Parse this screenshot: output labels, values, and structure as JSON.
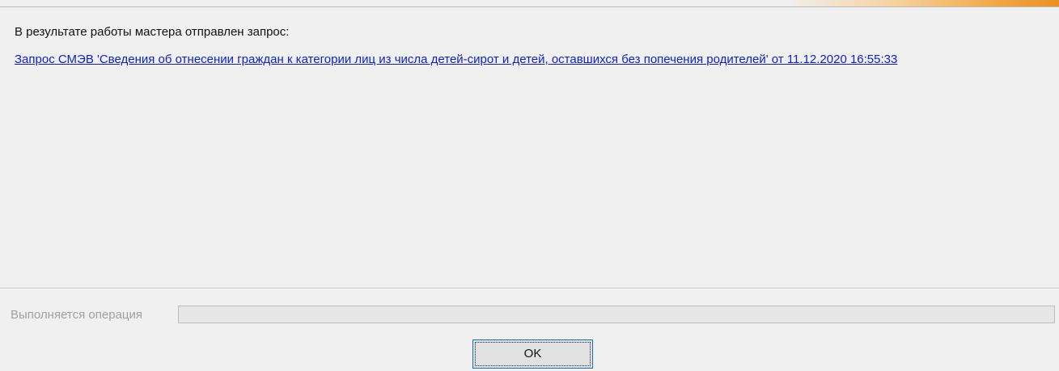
{
  "dialog": {
    "message": "В результате работы мастера отправлен запрос:",
    "request_link": "Запрос СМЭВ 'Сведения об отнесении граждан к категории лиц из числа детей-сирот и детей, оставшихся без попечения родителей' от 11.12.2020 16:55:33"
  },
  "status": {
    "label": "Выполняется операция",
    "progress": 0
  },
  "buttons": {
    "ok_label": "OK"
  },
  "colors": {
    "background": "#f0f0f0",
    "link": "#0f1fc9",
    "button_border": "#0d6fc6",
    "accent": "#eb9024"
  }
}
